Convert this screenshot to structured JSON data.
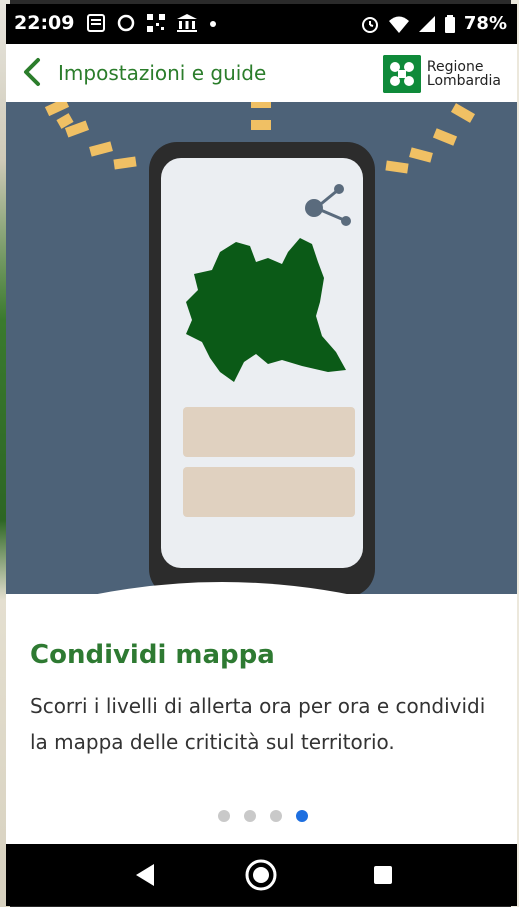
{
  "status_bar": {
    "time": "22:09",
    "battery_percent": "78%",
    "left_icons": [
      "notes-icon",
      "circle-icon",
      "qr-icon",
      "bank-icon",
      "dot-icon"
    ],
    "right_icons": [
      "alarm-icon",
      "wifi-icon",
      "signal-icon",
      "battery-icon"
    ]
  },
  "app_bar": {
    "back_icon": "chevron-left-icon",
    "title": "Impostazioni e guide",
    "logo_line1": "Regione",
    "logo_line2": "Lombardia"
  },
  "slide": {
    "title": "Condividi mappa",
    "description": "Scorri i livelli di allerta ora per ora e condividi la mappa delle criticità sul territorio.",
    "illustration_icons": [
      "phone-illustration",
      "share-icon",
      "lombardia-map"
    ],
    "pager": {
      "total": 4,
      "active_index": 3
    }
  },
  "nav_bar": {
    "buttons": [
      "back-triangle-icon",
      "home-circle-icon",
      "recents-square-icon"
    ]
  },
  "colors": {
    "accent_green": "#2e7a32",
    "hero_bg": "#4d6278",
    "map_green": "#0b5a17",
    "dash_yellow": "#f0c064",
    "pager_active": "#1e6fe0"
  }
}
